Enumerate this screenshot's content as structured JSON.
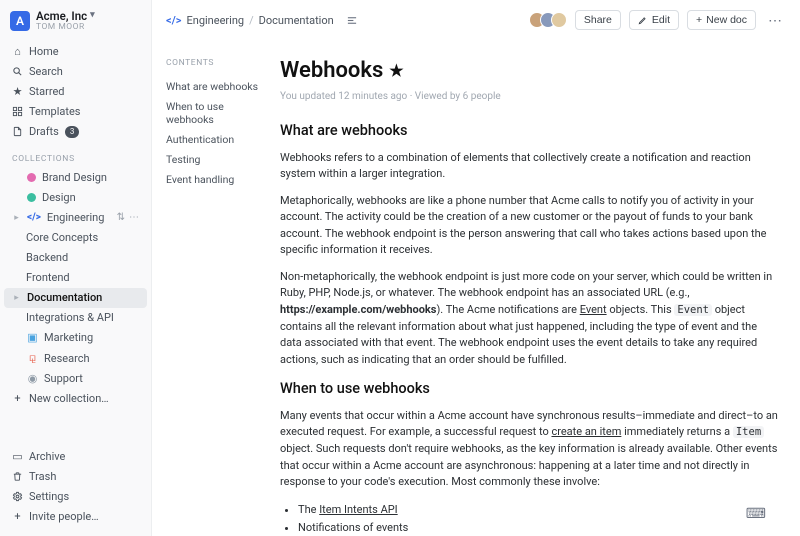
{
  "team": {
    "initial": "A",
    "name": "Acme, Inc",
    "subtitle": "TOM MOOR"
  },
  "nav": {
    "home": "Home",
    "search": "Search",
    "starred": "Starred",
    "templates": "Templates",
    "drafts": "Drafts",
    "drafts_badge": "3"
  },
  "sections": {
    "collections": "COLLECTIONS"
  },
  "collections": [
    {
      "label": "Brand Design",
      "color": "#e36bb0",
      "disc": false
    },
    {
      "label": "Design",
      "color": "#3bbea0",
      "disc": false
    },
    {
      "label": "Engineering",
      "color": "#356ae6",
      "disc": true,
      "actions": true,
      "children": [
        {
          "label": "Core Concepts"
        },
        {
          "label": "Backend"
        },
        {
          "label": "Frontend"
        },
        {
          "label": "Documentation",
          "selected": true,
          "disc": true
        },
        {
          "label": "Integrations & API"
        }
      ]
    },
    {
      "label": "Marketing",
      "color": "#4aa3df",
      "disc": false
    },
    {
      "label": "Research",
      "color": "#e7604c",
      "disc": false
    },
    {
      "label": "Support",
      "color": "#8e9aa6",
      "disc": false
    }
  ],
  "new_collection": "New collection…",
  "footer": {
    "archive": "Archive",
    "trash": "Trash",
    "settings": "Settings",
    "invite": "Invite people…"
  },
  "breadcrumb": {
    "collection": "Engineering",
    "page": "Documentation"
  },
  "topbar": {
    "share": "Share",
    "edit": "Edit",
    "new_doc": "New doc"
  },
  "toc": {
    "title": "CONTENTS",
    "items": [
      "What are webhooks",
      "When to use webhooks",
      "Authentication",
      "Testing",
      "Event handling"
    ]
  },
  "doc": {
    "title": "Webhooks",
    "meta": "You updated 12 minutes ago · Viewed by 6 people",
    "h_what": "What are webhooks",
    "p1": "Webhooks refers to a combination of elements that collectively create a notification and reaction system within a larger integration.",
    "p2a": "Metaphorically, webhooks are like a phone number that Acme calls to notify you of activity in your account. The activity could be the creation of a new customer or the payout of funds to your bank account. The webhook endpoint is the person answering that call who takes actions based upon the specific information it receives.",
    "p3a": "Non-metaphorically, the webhook endpoint is just more code on your server, which could be written in Ruby, PHP, Node.js, or whatever. The webhook endpoint has an associated URL (e.g., ",
    "p3_url": "https://example.com/webhooks",
    "p3b": "). The Acme notifications are ",
    "p3_link1": "Event",
    "p3c": " objects. This ",
    "p3_code": "Event",
    "p3d": " object contains all the relevant information about what just happened, including the type of event and the data associated with that event. The webhook endpoint uses the event details to take any required actions, such as indicating that an order should be fulfilled.",
    "h_when": "When to use webhooks",
    "p4a": "Many events that occur within a Acme account have synchronous results–immediate and direct–to an executed request. For example, a successful request to ",
    "p4_link": "create an item",
    "p4b": " immediately returns a ",
    "p4_code": "Item",
    "p4c": " object. Such requests don't require webhooks, as the key information is already available. Other events that occur within a Acme account are asynchronous: happening at a later time and not directly in response to your code's execution. Most commonly these involve:",
    "bul1_a": "The ",
    "bul1_link": "Item Intents API",
    "bul2": "Notifications of events"
  }
}
